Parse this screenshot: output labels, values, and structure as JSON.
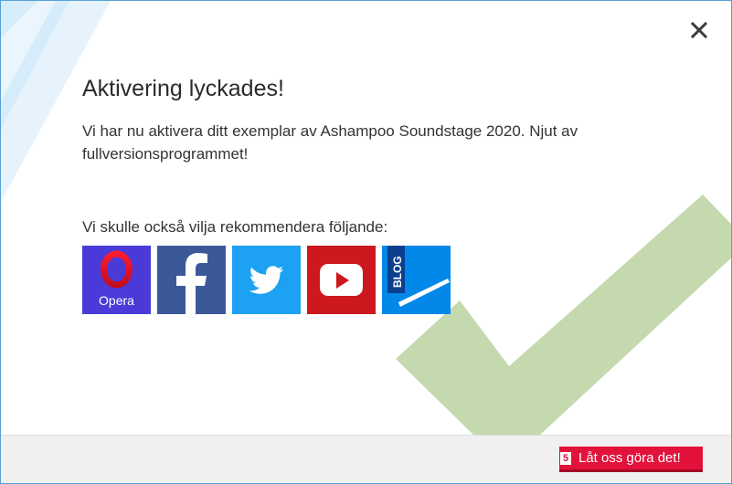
{
  "dialog": {
    "title": "Aktivering lyckades!",
    "message": "Vi har nu aktivera ditt exemplar av Ashampoo Soundstage 2020. Njut av fullversionsprogrammet!",
    "recommend_text": "Vi skulle också vilja rekommendera följande:",
    "close_icon": "close-icon"
  },
  "tiles": [
    {
      "icon": "opera-icon",
      "label": "Opera",
      "color": "#4a3bd8"
    },
    {
      "icon": "facebook-icon",
      "color": "#3b5998"
    },
    {
      "icon": "twitter-icon",
      "color": "#1da1f2"
    },
    {
      "icon": "youtube-icon",
      "color": "#cc181e"
    },
    {
      "icon": "blog-icon",
      "label": "BLOG",
      "color": "#0288e8"
    }
  ],
  "footer": {
    "countdown": "5",
    "button_label": "Låt oss göra det!"
  },
  "colors": {
    "accent": "#e3123b",
    "checkmark": "#c5d9ae",
    "border": "#5a9fd4"
  }
}
